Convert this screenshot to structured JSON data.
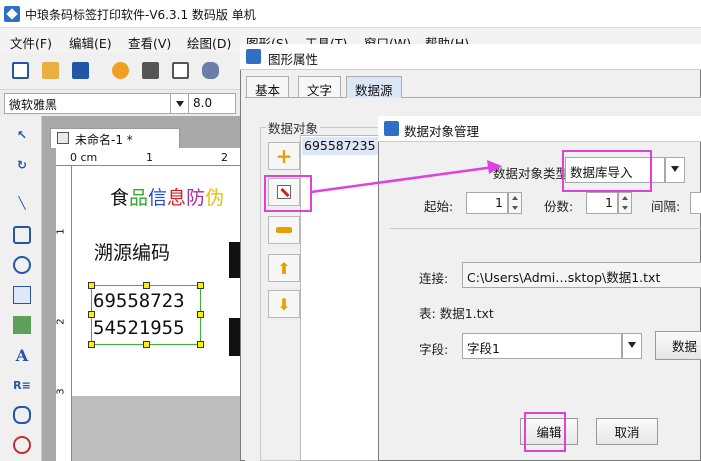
{
  "main_window": {
    "title": "中琅条码标签打印软件-V6.3.1 数码版 单机"
  },
  "menu": [
    "文件(F)",
    "编辑(E)",
    "查看(V)",
    "绘图(D)",
    "图形(S)",
    "工具(T)",
    "窗口(W)",
    "帮助(H)"
  ],
  "font_bar": {
    "font_name": "微软雅黑",
    "font_size": "8.0"
  },
  "document": {
    "tab_title": "未命名-1 *",
    "ruler_label": "0 cm",
    "ruler_num_1": "1",
    "ruler_num_2": "2",
    "left_ruler_1": "1",
    "left_ruler_2": "2",
    "left_ruler_3": "3",
    "canvas": {
      "line1_chars": [
        "食",
        "品",
        "信",
        "息",
        "防",
        "伪"
      ],
      "line1_colors": [
        "#111111",
        "#2fa82f",
        "#1a48d6",
        "#d62020",
        "#a82ea8",
        "#e6c200"
      ],
      "line2": "溯源编码",
      "number_line1": "69558723",
      "number_line2": "54521955"
    }
  },
  "properties_dialog": {
    "title": "图形属性",
    "tabs": [
      "基本",
      "文字",
      "数据源"
    ],
    "active_tab": 2,
    "group_label": "数据对象",
    "list_item": "695587235"
  },
  "data_object_manager": {
    "title": "数据对象管理",
    "type_label": "数据对象类型:",
    "type_value": "数据库导入",
    "start_label": "起始:",
    "start_value": "1",
    "copies_label": "份数:",
    "copies_value": "1",
    "interval_label": "间隔:",
    "connection_label": "连接:",
    "connection_value": "C:\\Users\\Admi…sktop\\数据1.txt",
    "table_label": "表:",
    "table_value": "数据1.txt",
    "field_label": "字段:",
    "field_value": "字段1",
    "data_button": "数据",
    "edit_button": "编辑",
    "cancel_button": "取消"
  },
  "colors": {
    "highlight": "#e040e0",
    "accent": "#2f6fc6"
  }
}
